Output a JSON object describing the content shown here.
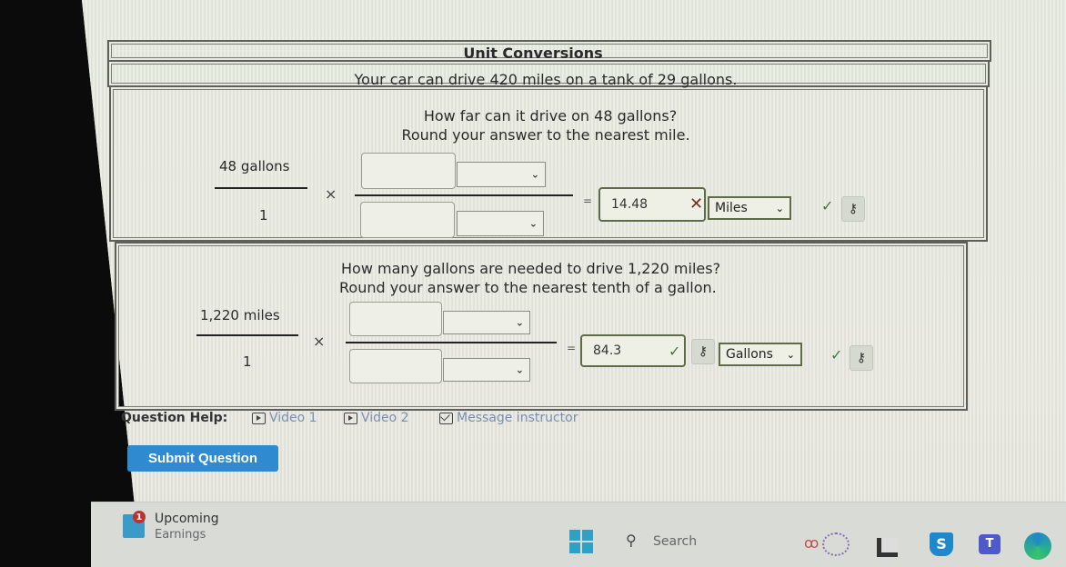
{
  "problem": {
    "title": "Unit Conversions",
    "intro": "Your car can drive 420 miles on a tank of 29 gallons."
  },
  "question1": {
    "prompt": "How far can it drive on 48 gallons?",
    "rounding": "Round your answer to the nearest mile.",
    "given_numerator": "48 gallons",
    "given_denominator": "1",
    "times": "×",
    "equals": "=",
    "factor_numerator_value": "",
    "factor_numerator_unit": "",
    "factor_denominator_value": "",
    "factor_denominator_unit": "",
    "answer_value": "14.48",
    "answer_status": "incorrect",
    "answer_status_icon": "x-mark-icon",
    "unit_selected": "Miles",
    "unit_status": "correct",
    "key_icon": "key-icon"
  },
  "question2": {
    "prompt": "How many gallons are needed to drive 1,220 miles?",
    "rounding": "Round your answer to the nearest tenth of a gallon.",
    "given_numerator": "1,220 miles",
    "given_denominator": "1",
    "times": "×",
    "equals": "=",
    "factor_numerator_value": "",
    "factor_numerator_unit": "",
    "factor_denominator_value": "",
    "factor_denominator_unit": "",
    "answer_value": "84.3",
    "answer_status": "correct",
    "unit_selected": "Gallons",
    "unit_status": "correct",
    "key_icon": "key-icon"
  },
  "help": {
    "label": "Question Help:",
    "links": [
      {
        "label": "Video 1",
        "icon": "play-video-icon"
      },
      {
        "label": "Video 2",
        "icon": "play-video-icon"
      },
      {
        "label": "Message instructor",
        "icon": "mail-icon"
      }
    ]
  },
  "submit_label": "Submit Question",
  "taskbar": {
    "widget_badge": "1",
    "widget_line1": "Upcoming",
    "widget_line2": "Earnings",
    "search_label": "Search",
    "glyphs": {
      "chevron": "⌄",
      "check": "✓",
      "x": "✕",
      "key": "⚷",
      "search": "⚲"
    },
    "accent_color": "#2f8ad0"
  }
}
